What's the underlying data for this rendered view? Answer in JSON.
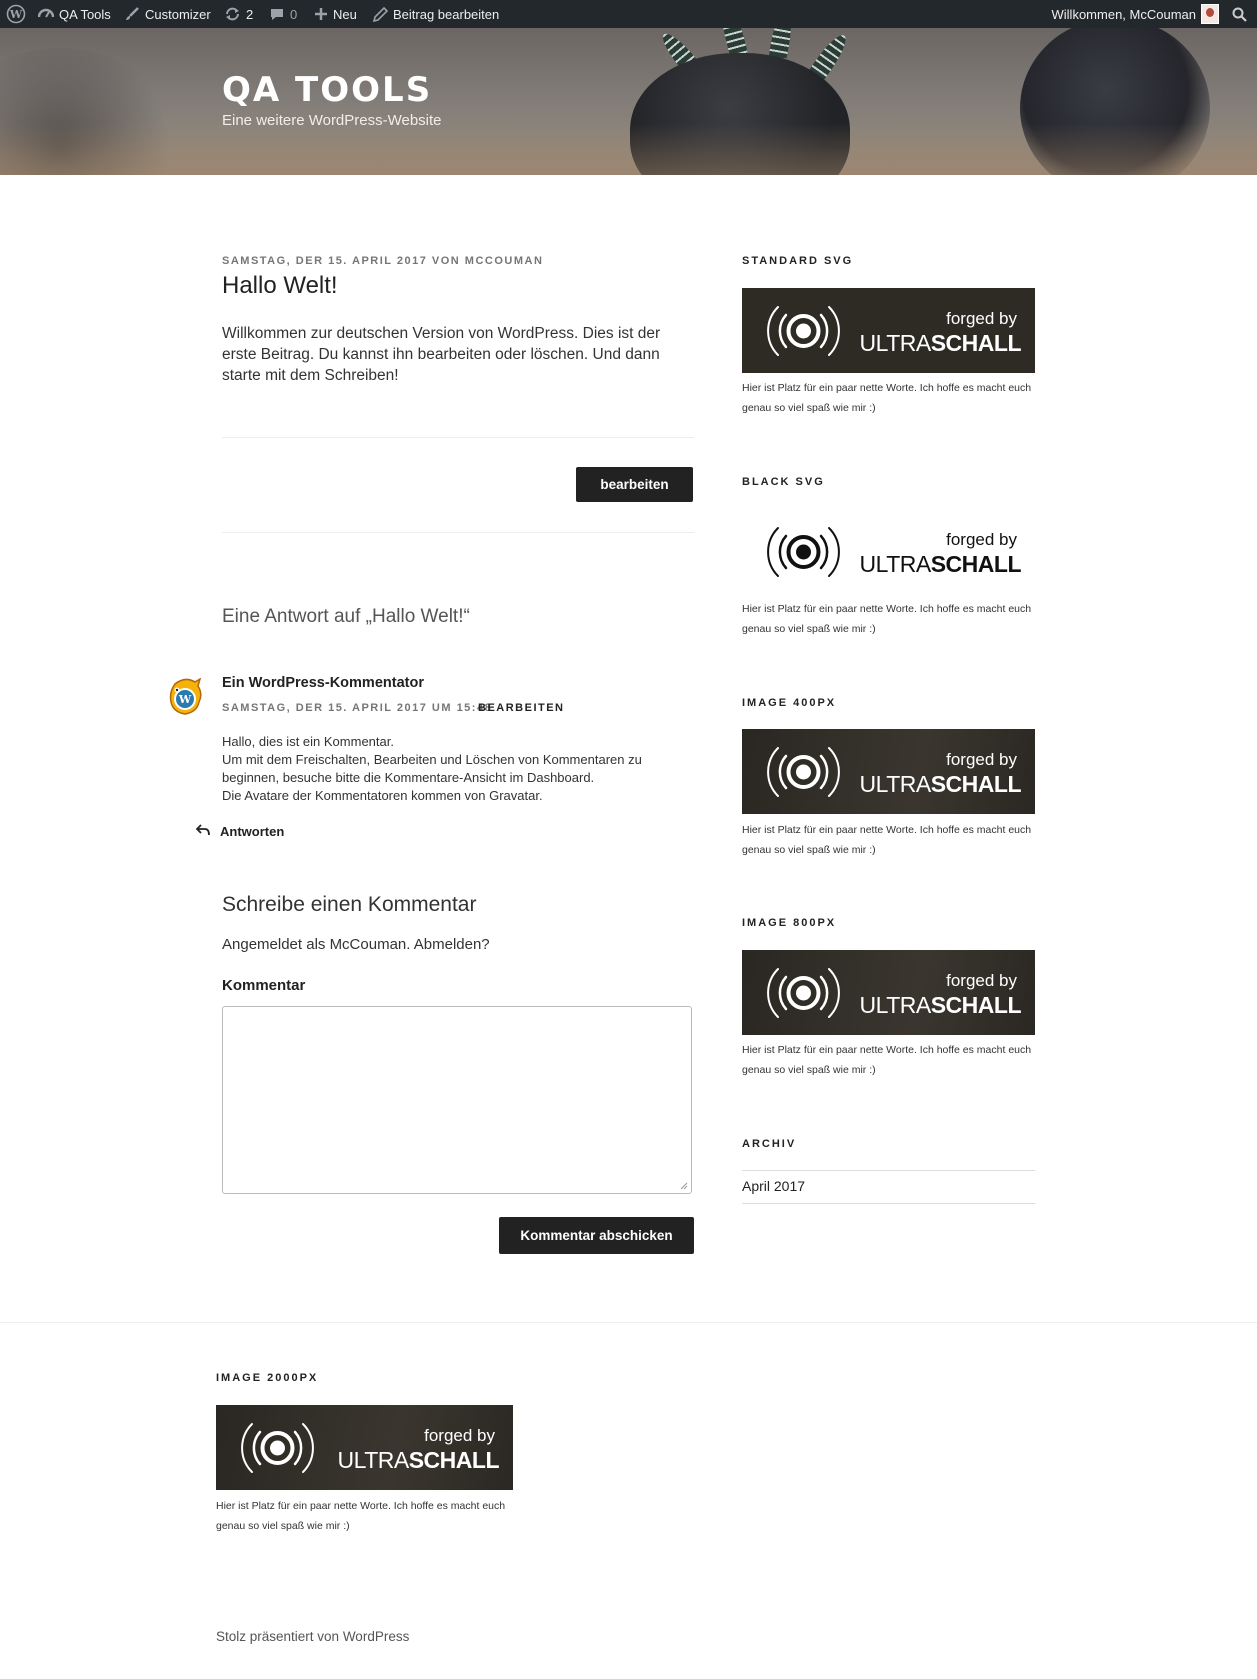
{
  "admin_bar": {
    "site_name": "QA Tools",
    "customizer": "Customizer",
    "updates_count": "2",
    "comments_count": "0",
    "new": "Neu",
    "edit_post": "Beitrag bearbeiten",
    "greeting": "Willkommen, McCouman",
    "icons": [
      "wordpress-logo-icon",
      "dashboard-icon",
      "brush-icon",
      "updates-icon",
      "comment-icon",
      "plus-icon",
      "pencil-icon",
      "search-icon"
    ]
  },
  "header": {
    "site_title": "QA TOOLS",
    "tagline": "Eine weitere WordPress-Website"
  },
  "post": {
    "date_line": "SAMSTAG, DER 15. APRIL 2017 VON ",
    "author": "MCCOUMAN",
    "title": "Hallo Welt!",
    "content": "Willkommen zur deutschen Version von WordPress. Dies ist der erste Beitrag. Du kannst ihn bearbeiten oder löschen. Und dann starte mit dem Schreiben!",
    "edit_button": "bearbeiten"
  },
  "comments": {
    "title": "Eine Antwort auf „Hallo Welt!“",
    "items": [
      {
        "author": "Ein WordPress-Kommentator",
        "date": "SAMSTAG, DER 15. APRIL 2017 UM 15:48",
        "edit": "BEARBEITEN",
        "lines": [
          "Hallo, dies ist ein Kommentar.",
          "Um mit dem Freischalten, Bearbeiten und Löschen von Kommentaren zu beginnen, besuche bitte die Kommentare-Ansicht im Dashboard.",
          "Die Avatare der Kommentatoren kommen von Gravatar."
        ],
        "reply": "Antworten"
      }
    ]
  },
  "respond": {
    "title": "Schreibe einen Kommentar",
    "logged_in": "Angemeldet als McCouman. Abmelden?",
    "label": "Kommentar",
    "submit": "Kommentar abschicken"
  },
  "logo": {
    "forged": "forged by",
    "ultra": "ULTRA",
    "schall": "SCHALL"
  },
  "sidebar": {
    "widgets": [
      {
        "title": "STANDARD SVG",
        "caption": "Hier ist Platz für ein paar nette Worte. Ich hoffe es macht euch genau so viel spaß wie mir :)"
      },
      {
        "title": "BLACK SVG",
        "caption": "Hier ist Platz für ein paar nette Worte. Ich hoffe es macht euch genau so viel spaß wie mir :)"
      },
      {
        "title": "IMAGE 400PX",
        "caption": "Hier ist Platz für ein paar nette Worte. Ich hoffe es macht euch genau so viel spaß wie mir :)"
      },
      {
        "title": "IMAGE 800PX",
        "caption": "Hier ist Platz für ein paar nette Worte. Ich hoffe es macht euch genau so viel spaß wie mir :)"
      }
    ],
    "archive": {
      "title": "ARCHIV",
      "items": [
        "April 2017"
      ]
    }
  },
  "footer": {
    "widget_title": "IMAGE 2000PX",
    "widget_caption": "Hier ist Platz für ein paar nette Worte. Ich hoffe es macht euch genau so viel spaß wie mir :)",
    "site_info": "Stolz präsentiert von WordPress"
  },
  "colors": {
    "admin_bar": "#23282d",
    "button": "#222222",
    "logo_bg": "#2e2b25"
  }
}
